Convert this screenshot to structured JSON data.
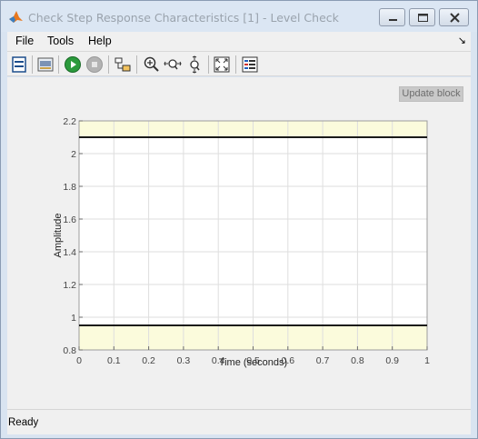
{
  "window": {
    "title": "Check Step Response Characteristics [1] - Level Check"
  },
  "menu": {
    "file": "File",
    "tools": "Tools",
    "help": "Help"
  },
  "toolbar": {
    "icons": [
      "print-icon",
      "export-icon",
      "run-icon",
      "stop-icon",
      "block-icon",
      "zoom-in-icon",
      "zoom-x-icon",
      "zoom-y-icon",
      "fit-icon",
      "legend-icon"
    ]
  },
  "content": {
    "update_block_label": "Update block"
  },
  "chart_data": {
    "type": "line",
    "title": "",
    "xlabel": "Time (seconds)",
    "ylabel": "Amplitude",
    "xlim": [
      0,
      1
    ],
    "ylim": [
      0.8,
      2.2
    ],
    "xticks": [
      "0",
      "0.1",
      "0.2",
      "0.3",
      "0.4",
      "0.5",
      "0.6",
      "0.7",
      "0.8",
      "0.9",
      "1"
    ],
    "yticks": [
      "0.8",
      "1",
      "1.2",
      "1.4",
      "1.6",
      "1.8",
      "2",
      "2.2"
    ],
    "grid": true,
    "bounds": [
      {
        "name": "",
        "y": 2.1
      },
      {
        "name": "",
        "y": 0.95
      }
    ],
    "shaded_regions": [
      {
        "y0": 2.1,
        "y1": 2.2,
        "color": "#fbfbdc"
      },
      {
        "y0": 0.8,
        "y1": 0.95,
        "color": "#fbfbdc"
      }
    ]
  },
  "status": {
    "text": "Ready"
  }
}
